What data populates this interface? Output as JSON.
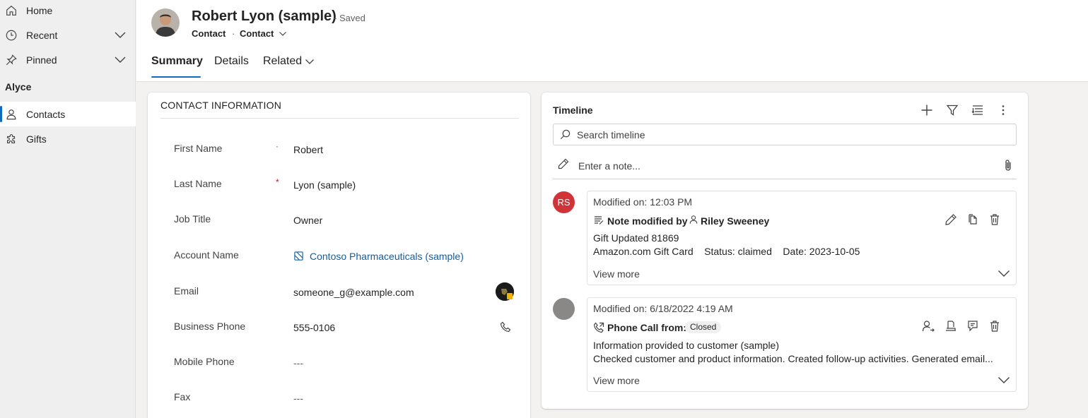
{
  "sidebar": {
    "items": [
      {
        "label": "Home",
        "icon": "home-icon"
      },
      {
        "label": "Recent",
        "icon": "clock-icon"
      },
      {
        "label": "Pinned",
        "icon": "pin-icon"
      },
      {
        "label": "Contacts",
        "icon": "person-icon"
      },
      {
        "label": "Gifts",
        "icon": "puzzle-icon"
      }
    ],
    "group_label": "Alyce"
  },
  "record": {
    "title": "Robert Lyon (sample)",
    "saved_status": "- Saved",
    "entity": "Contact",
    "separator": "·",
    "form_name": "Contact"
  },
  "tabs": [
    {
      "label": "Summary"
    },
    {
      "label": "Details"
    },
    {
      "label": "Related"
    }
  ],
  "contact_info": {
    "section_title": "CONTACT INFORMATION",
    "fields": [
      {
        "label": "First Name",
        "value": "Robert",
        "required_marker": "·"
      },
      {
        "label": "Last Name",
        "value": "Lyon (sample)",
        "required_marker": "*"
      },
      {
        "label": "Job Title",
        "value": "Owner"
      },
      {
        "label": "Account Name",
        "value": "Contoso Pharmaceuticals (sample)"
      },
      {
        "label": "Email",
        "value": "someone_g@example.com"
      },
      {
        "label": "Business Phone",
        "value": "555-0106"
      },
      {
        "label": "Mobile Phone",
        "value": "---"
      },
      {
        "label": "Fax",
        "value": "---"
      }
    ]
  },
  "timeline": {
    "title": "Timeline",
    "search_placeholder": "Search timeline",
    "note_placeholder": "Enter a note...",
    "entries": [
      {
        "avatar_initials": "RS",
        "avatar_color": "#d13438",
        "modified": "Modified on: 12:03 PM",
        "heading": "Note modified by",
        "author": "Riley Sweeney",
        "line1": "Gift Updated 81869",
        "line2": "Amazon.com Gift Card    Status: claimed    Date: 2023-10-05",
        "view_more": "View more"
      },
      {
        "avatar_initials": "",
        "avatar_color": "#8a8886",
        "modified": "Modified on: 6/18/2022 4:19 AM",
        "heading": "Phone Call from:",
        "badge": "Closed",
        "line1": "Information provided to customer (sample)",
        "line2": "Checked customer and product information. Created follow-up activities. Generated email...",
        "view_more": "View more"
      }
    ]
  },
  "colors": {
    "accent": "#0f6cbd",
    "link": "#115ea3",
    "required": "#c50f1f"
  }
}
